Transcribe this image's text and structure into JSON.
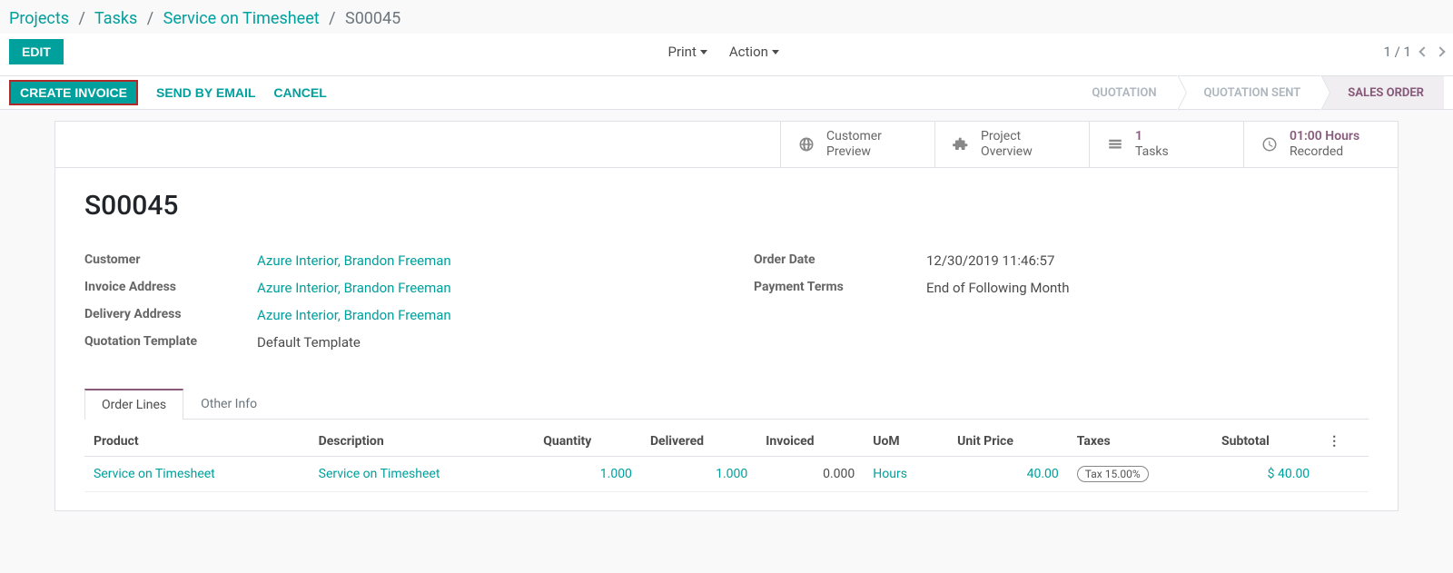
{
  "breadcrumb": {
    "items": [
      "Projects",
      "Tasks",
      "Service on Timesheet"
    ],
    "current": "S00045"
  },
  "controls": {
    "edit": "EDIT",
    "print": "Print",
    "action": "Action",
    "pager": "1 / 1"
  },
  "toolbar": {
    "create_invoice": "CREATE INVOICE",
    "send_email": "SEND BY EMAIL",
    "cancel": "CANCEL"
  },
  "status_steps": {
    "quotation": "QUOTATION",
    "quotation_sent": "QUOTATION SENT",
    "sales_order": "SALES ORDER"
  },
  "stat_buttons": {
    "customer_preview_l1": "Customer",
    "customer_preview_l2": "Preview",
    "project_overview_l1": "Project",
    "project_overview_l2": "Overview",
    "tasks_count": "1",
    "tasks_label": "Tasks",
    "hours_value": "01:00 Hours",
    "hours_label": "Recorded"
  },
  "record": {
    "title": "S00045",
    "fields_left": {
      "customer_label": "Customer",
      "customer_value": "Azure Interior, Brandon Freeman",
      "invoice_addr_label": "Invoice Address",
      "invoice_addr_value": "Azure Interior, Brandon Freeman",
      "delivery_addr_label": "Delivery Address",
      "delivery_addr_value": "Azure Interior, Brandon Freeman",
      "template_label": "Quotation Template",
      "template_value": "Default Template"
    },
    "fields_right": {
      "order_date_label": "Order Date",
      "order_date_value": "12/30/2019 11:46:57",
      "payment_terms_label": "Payment Terms",
      "payment_terms_value": "End of Following Month"
    }
  },
  "tabs": {
    "order_lines": "Order Lines",
    "other_info": "Other Info"
  },
  "table": {
    "headers": {
      "product": "Product",
      "description": "Description",
      "quantity": "Quantity",
      "delivered": "Delivered",
      "invoiced": "Invoiced",
      "uom": "UoM",
      "unit_price": "Unit Price",
      "taxes": "Taxes",
      "subtotal": "Subtotal"
    },
    "row": {
      "product": "Service on Timesheet",
      "description": "Service on Timesheet",
      "quantity": "1.000",
      "delivered": "1.000",
      "invoiced": "0.000",
      "uom": "Hours",
      "unit_price": "40.00",
      "taxes": "Tax 15.00%",
      "subtotal": "$ 40.00"
    }
  }
}
